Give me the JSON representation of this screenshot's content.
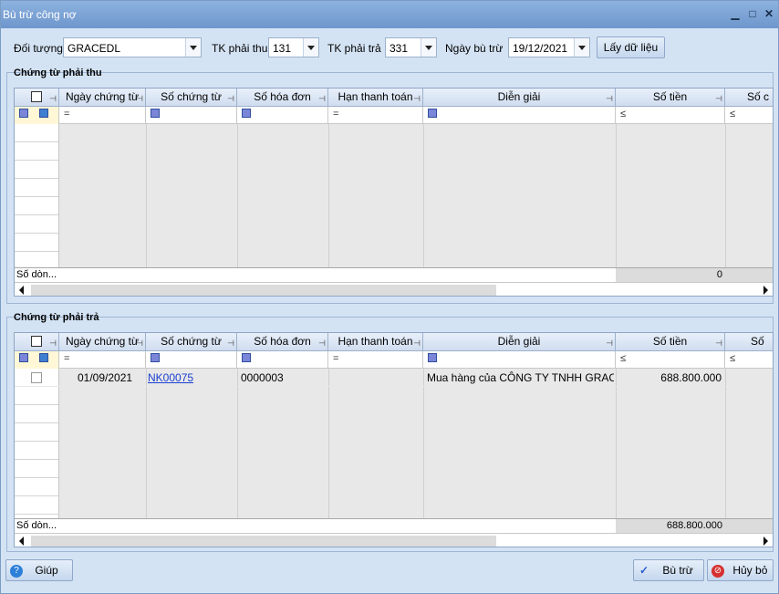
{
  "window": {
    "title": "Bù trừ công nợ"
  },
  "topbar": {
    "doi_tuong_label": "Đối tượng",
    "doi_tuong_value": "GRACEDL",
    "tk_phai_thu_label": "TK phải thu",
    "tk_phai_thu_value": "131",
    "tk_phai_tra_label": "TK phải trả",
    "tk_phai_tra_value": "331",
    "ngay_bu_tru_label": "Ngày bù trừ",
    "ngay_bu_tru_value": "19/12/2021",
    "lay_du_lieu_label": "Lấy dữ liệu"
  },
  "grid_columns": [
    "Ngày chứng từ",
    "Số chứng từ",
    "Số hóa đơn",
    "Hạn thanh toán",
    "Diễn giải",
    "Số tiền",
    "Số c"
  ],
  "grid_columns_tra": [
    "Ngày chứng từ",
    "Số chứng từ",
    "Số hóa đơn",
    "Hạn thanh toán",
    "Diễn giải",
    "Số tiền",
    "Số"
  ],
  "filter_ops": {
    "eq": "=",
    "le": "≤"
  },
  "phai_thu": {
    "title": "Chứng từ phải thu",
    "footer_label": "Số dòn...",
    "footer_total": "0"
  },
  "phai_tra": {
    "title": "Chứng từ phải trả",
    "rows": [
      {
        "ngay": "01/09/2021",
        "so_ct": "NK00075",
        "so_hd": "0000003",
        "han": "",
        "dien_giai": "Mua hàng của CÔNG TY TNHH GRAC...",
        "so_tien": "688.800.000"
      }
    ],
    "footer_label": "Số dòn...",
    "footer_total": "688.800.000"
  },
  "bottom": {
    "help_label": "Giúp",
    "ok_label": "Bù trừ",
    "cancel_label": "Hủy bỏ"
  },
  "colors": {
    "title_bar": "#7aa1d4",
    "window_bg": "#d4e3f4",
    "link": "#1a3fd0"
  }
}
